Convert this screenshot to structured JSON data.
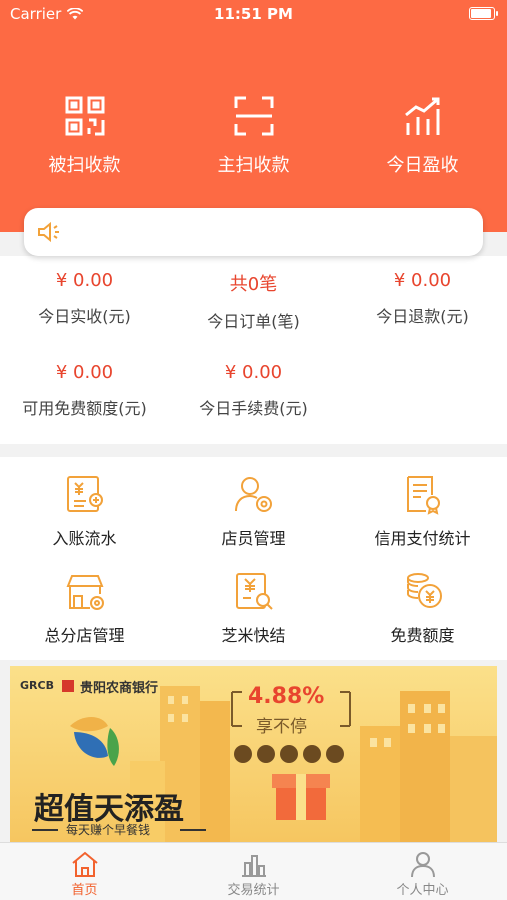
{
  "status_bar": {
    "carrier": "Carrier",
    "time": "11:51 PM"
  },
  "quick_actions": [
    {
      "label": "被扫收款",
      "icon": "qr-code-icon"
    },
    {
      "label": "主扫收款",
      "icon": "scan-frame-icon"
    },
    {
      "label": "今日盈收",
      "icon": "bar-chart-trend-icon"
    }
  ],
  "notice": {
    "icon": "speaker-icon",
    "text": ""
  },
  "stats": [
    {
      "value": "¥ 0.00",
      "label": "今日实收(元)"
    },
    {
      "value": "共0笔",
      "label": "今日订单(笔)"
    },
    {
      "value": "¥ 0.00",
      "label": "今日退款(元)"
    },
    {
      "value": "¥ 0.00",
      "label": "可用免费额度(元)"
    },
    {
      "value": "¥ 0.00",
      "label": "今日手续费(元)"
    }
  ],
  "menu": [
    {
      "label": "入账流水",
      "icon": "ledger-icon"
    },
    {
      "label": "店员管理",
      "icon": "staff-settings-icon"
    },
    {
      "label": "信用支付统计",
      "icon": "certificate-icon"
    },
    {
      "label": "总分店管理",
      "icon": "store-settings-icon"
    },
    {
      "label": "芝米快结",
      "icon": "bill-search-icon"
    },
    {
      "label": "免费额度",
      "icon": "coins-icon"
    }
  ],
  "banner": {
    "brand": "GRCB",
    "bank_name": "贵阳农商银行",
    "rate": "4.88%",
    "rate_caption": "享不停",
    "headline": "超值天添盈",
    "subline": "每天赚个早餐钱"
  },
  "tabbar": [
    {
      "label": "首页",
      "icon": "home-icon",
      "active": true
    },
    {
      "label": "交易统计",
      "icon": "bar-chart-icon",
      "active": false
    },
    {
      "label": "个人中心",
      "icon": "person-icon",
      "active": false
    }
  ],
  "colors": {
    "brand_orange": "#fd6a44",
    "value_red": "#e8452e",
    "icon_orange": "#f2a23a"
  }
}
